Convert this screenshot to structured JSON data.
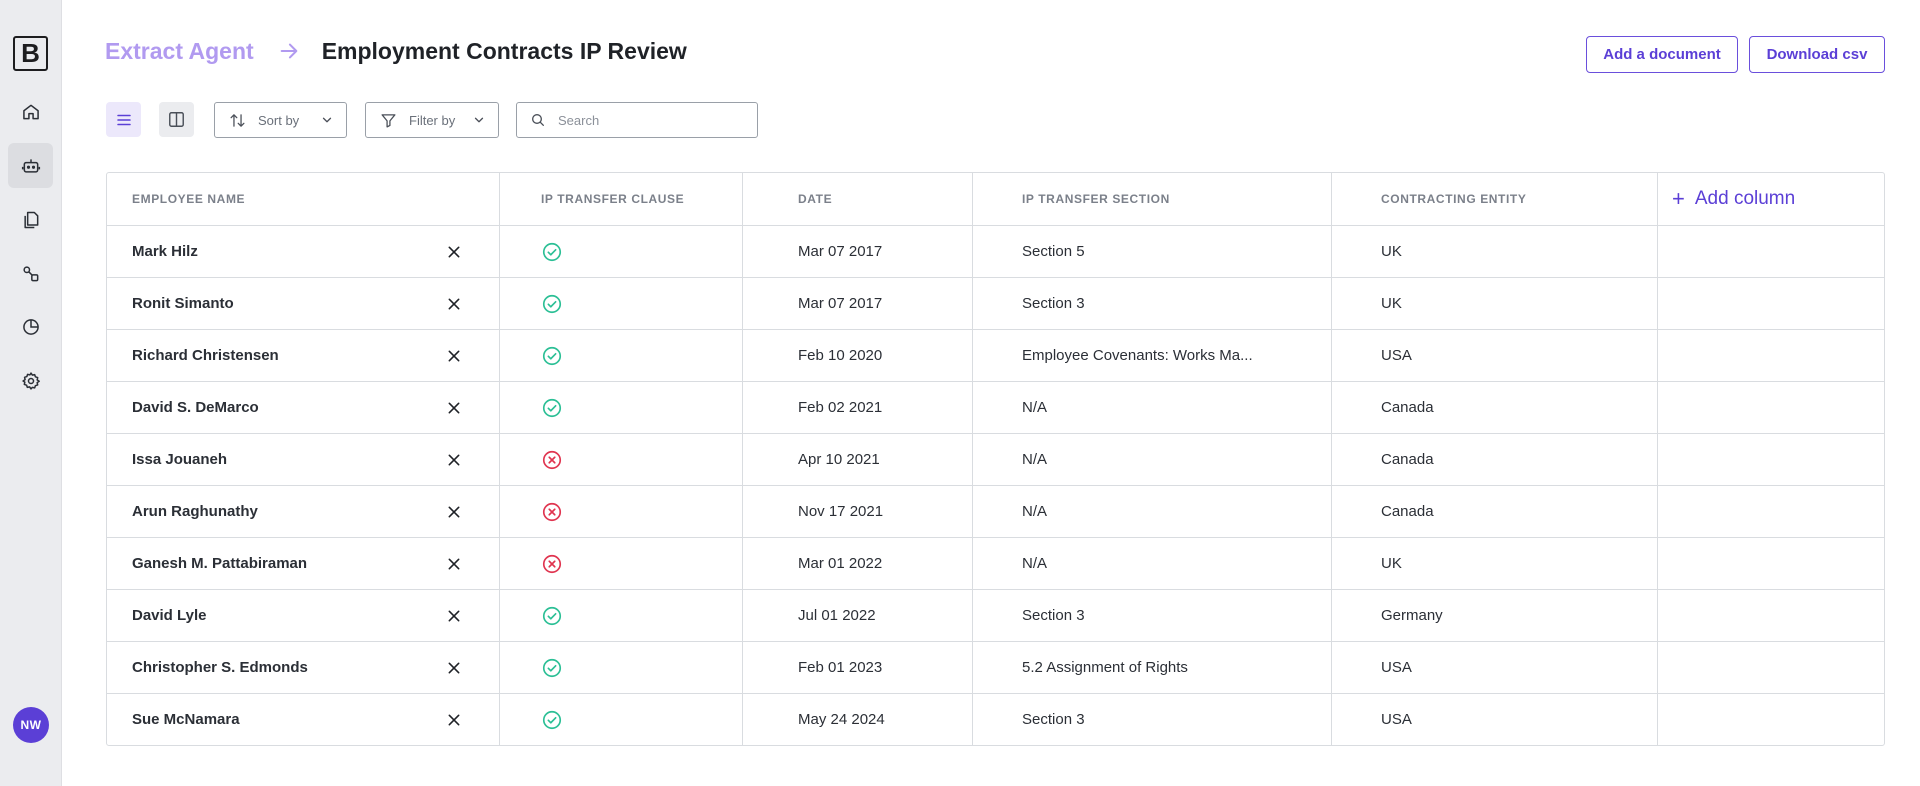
{
  "sidebar": {
    "logo": "B",
    "items": [
      {
        "name": "home-icon"
      },
      {
        "name": "robot-icon"
      },
      {
        "name": "documents-icon"
      },
      {
        "name": "workflow-icon"
      },
      {
        "name": "pie-chart-icon"
      },
      {
        "name": "gear-icon"
      }
    ],
    "active_index": 1,
    "avatar_initials": "NW"
  },
  "header": {
    "breadcrumb_root": "Extract Agent",
    "title": "Employment Contracts IP Review",
    "add_document_label": "Add a document",
    "download_csv_label": "Download csv"
  },
  "toolbar": {
    "sort_label": "Sort by",
    "filter_label": "Filter by",
    "search_placeholder": "Search"
  },
  "table": {
    "columns": [
      "EMPLOYEE NAME",
      "IP TRANSFER CLAUSE",
      "DATE",
      "IP TRANSFER SECTION",
      "CONTRACTING ENTITY"
    ],
    "add_column_label": "Add column",
    "rows": [
      {
        "name": "Mark Hilz",
        "clause": "yes",
        "date": "Mar 07 2017",
        "section": "Section 5",
        "entity": "UK"
      },
      {
        "name": "Ronit Simanto",
        "clause": "yes",
        "date": "Mar 07 2017",
        "section": "Section 3",
        "entity": "UK"
      },
      {
        "name": "Richard Christensen",
        "clause": "yes",
        "date": "Feb 10 2020",
        "section": "Employee Covenants: Works Ma...",
        "entity": "USA"
      },
      {
        "name": "David S. DeMarco",
        "clause": "yes",
        "date": "Feb 02 2021",
        "section": "N/A",
        "entity": "Canada"
      },
      {
        "name": "Issa Jouaneh",
        "clause": "no",
        "date": "Apr 10 2021",
        "section": "N/A",
        "entity": "Canada"
      },
      {
        "name": "Arun Raghunathy",
        "clause": "no",
        "date": "Nov 17 2021",
        "section": "N/A",
        "entity": "Canada"
      },
      {
        "name": "Ganesh M. Pattabiraman",
        "clause": "no",
        "date": "Mar 01 2022",
        "section": "N/A",
        "entity": "UK"
      },
      {
        "name": "David Lyle",
        "clause": "yes",
        "date": "Jul 01 2022",
        "section": "Section 3",
        "entity": "Germany"
      },
      {
        "name": "Christopher S. Edmonds",
        "clause": "yes",
        "date": "Feb 01 2023",
        "section": "5.2 Assignment of Rights",
        "entity": "USA"
      },
      {
        "name": "Sue McNamara",
        "clause": "yes",
        "date": "May 24 2024",
        "section": "Section 3",
        "entity": "USA"
      }
    ]
  },
  "colors": {
    "accent": "#5b3fd6",
    "accent_light": "#b19af0",
    "status_yes": "#2bbf95",
    "status_no": "#e0344f"
  }
}
